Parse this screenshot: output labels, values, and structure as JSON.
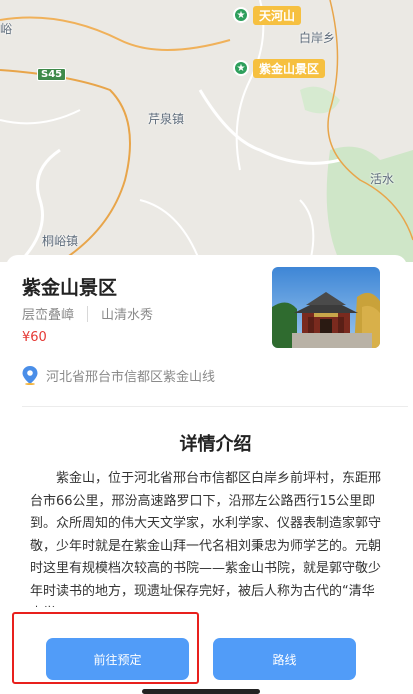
{
  "map": {
    "labels": {
      "tianhe": "天河山",
      "baian": "白岸乡",
      "ziyin": "紫金山景区",
      "s45": "S45",
      "qiquan": "芹泉镇",
      "yu": "峪",
      "shui": "活水",
      "tongyu": "桐峪镇"
    },
    "pin_icons": [
      "hiking-icon",
      "hiking-icon"
    ],
    "pin_color": "#2e9f5c",
    "tag_color": "#f6c040"
  },
  "spot": {
    "name": "紫金山景区",
    "tags": [
      "层峦叠嶂",
      "山清水秀"
    ],
    "price": "¥60",
    "address": "河北省邢台市信都区紫金山线"
  },
  "detail": {
    "heading": "详情介绍",
    "text": "紫金山，位于河北省邢台市信都区白岸乡前坪村，东距邢台市66公里，邢汾高速路罗口下，沿邢左公路西行15公里即到。众所周知的伟大天文学家，水利学家、仪器表制造家郭守敬，少年时就是在紫金山拜一代名相刘秉忠为师学艺的。元朝时这里有规模档次较高的书院——紫金山书院，就是郭守敬少年时读书的地方，现遗址保存完好，被后人称为古代的“清华大学”。"
  },
  "buttons": {
    "book": "前往预定",
    "route": "路线"
  },
  "colors": {
    "accent": "#519cf8",
    "price": "#e53935",
    "highlight_box": "#e8201d"
  }
}
